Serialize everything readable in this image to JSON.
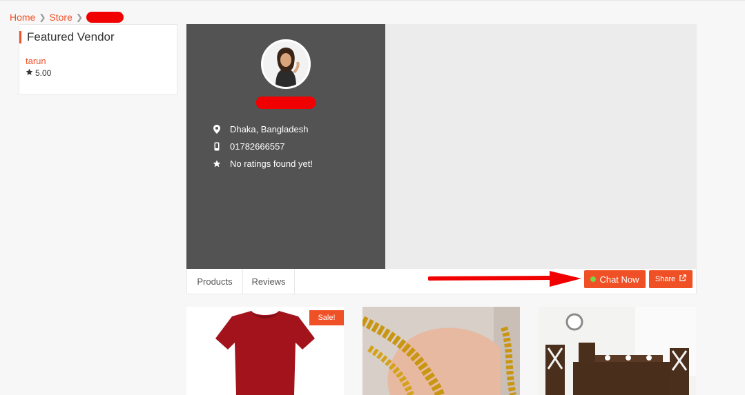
{
  "breadcrumb": {
    "home": "Home",
    "store": "Store"
  },
  "sidebar": {
    "widget_title": "Featured Vendor",
    "vendor_name": "tarun",
    "vendor_rating": "5.00"
  },
  "store": {
    "location": "Dhaka, Bangladesh",
    "phone": "01782666557",
    "rating_text": "No ratings found yet!"
  },
  "tabs": [
    {
      "label": "Products"
    },
    {
      "label": "Reviews"
    }
  ],
  "actions": {
    "chat_label": "Chat Now",
    "share_label": "Share"
  },
  "products": [
    {
      "badge": "Sale!",
      "image": "red-tshirt"
    },
    {
      "image": "gold-chain"
    },
    {
      "image": "dining-table"
    }
  ],
  "colors": {
    "accent": "#f05025",
    "profile_bg": "#535353",
    "online": "#77d649",
    "redaction": "#f00000"
  }
}
